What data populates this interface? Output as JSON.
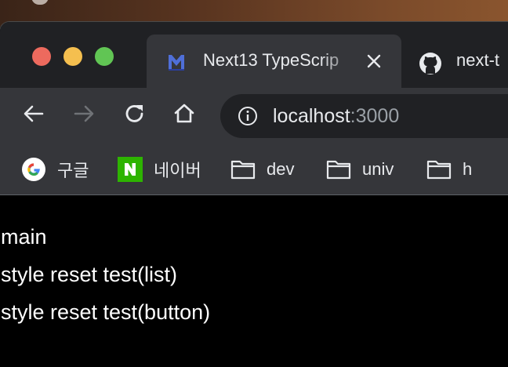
{
  "tabs": [
    {
      "title": "Next13 TypeScrip",
      "active": true,
      "favicon": "next-m-logo-icon"
    },
    {
      "title": "next-t",
      "active": false,
      "favicon": "github-icon"
    }
  ],
  "toolbar": {
    "url_host": "localhost",
    "url_port": ":3000"
  },
  "bookmarks": [
    {
      "label": "구글",
      "icon": "google-icon"
    },
    {
      "label": "네이버",
      "icon": "naver-icon"
    },
    {
      "label": "dev",
      "icon": "folder-icon"
    },
    {
      "label": "univ",
      "icon": "folder-icon"
    },
    {
      "label": "h",
      "icon": "folder-icon"
    }
  ],
  "page": {
    "lines": [
      "main",
      "style reset test(list)",
      "style reset test(button)"
    ]
  }
}
